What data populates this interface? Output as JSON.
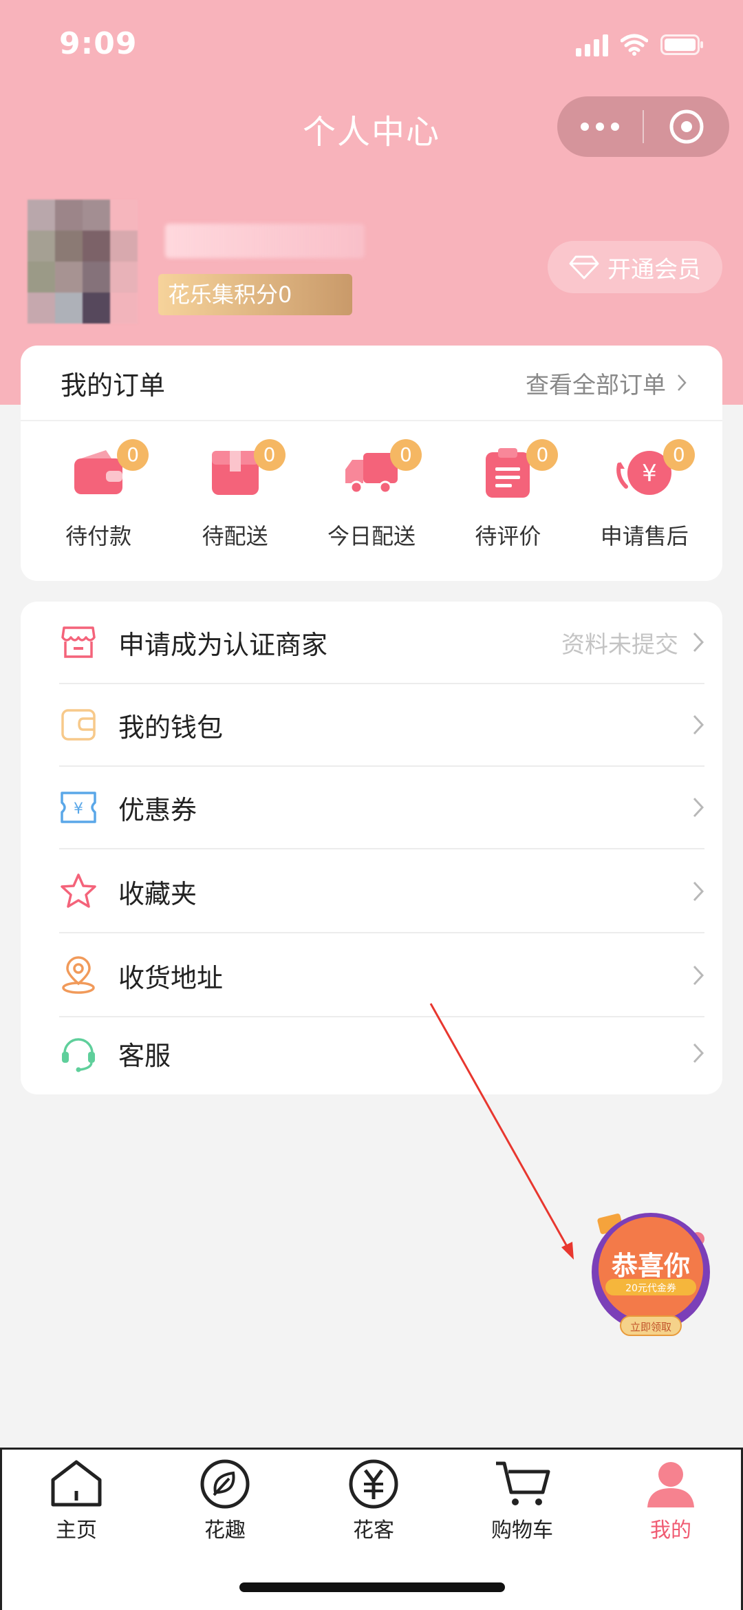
{
  "status_bar": {
    "time": "9:09"
  },
  "header": {
    "title": "个人中心"
  },
  "profile": {
    "points_label": "花乐集积分0",
    "vip_button": "开通会员"
  },
  "orders": {
    "title": "我的订单",
    "view_all": "查看全部订单",
    "items": [
      {
        "label": "待付款",
        "count": "0",
        "icon": "wallet-icon"
      },
      {
        "label": "待配送",
        "count": "0",
        "icon": "package-icon"
      },
      {
        "label": "今日配送",
        "count": "0",
        "icon": "truck-icon"
      },
      {
        "label": "待评价",
        "count": "0",
        "icon": "clipboard-icon"
      },
      {
        "label": "申请售后",
        "count": "0",
        "icon": "refund-icon"
      }
    ]
  },
  "menu": {
    "items": [
      {
        "label": "申请成为认证商家",
        "status": "资料未提交",
        "icon": "store-icon"
      },
      {
        "label": "我的钱包",
        "status": "",
        "icon": "wallet-outline-icon"
      },
      {
        "label": "优惠券",
        "status": "",
        "icon": "coupon-icon"
      },
      {
        "label": "收藏夹",
        "status": "",
        "icon": "star-icon"
      },
      {
        "label": "收货地址",
        "status": "",
        "icon": "location-icon"
      },
      {
        "label": "客服",
        "status": "",
        "icon": "headset-icon"
      }
    ]
  },
  "promo": {
    "title": "恭喜你",
    "subtitle": "20元代金券",
    "action": "立即领取"
  },
  "tabbar": {
    "items": [
      {
        "label": "主页",
        "icon": "home-icon",
        "active": false
      },
      {
        "label": "花趣",
        "icon": "leaf-icon",
        "active": false
      },
      {
        "label": "花客",
        "icon": "yuan-icon",
        "active": false
      },
      {
        "label": "购物车",
        "icon": "cart-icon",
        "active": false
      },
      {
        "label": "我的",
        "icon": "person-icon",
        "active": true
      }
    ]
  },
  "colors": {
    "header_pink": "#f8b3bb",
    "accent_red": "#f05b72",
    "badge_orange": "#f5b763",
    "arrow_red": "#e8372f"
  }
}
